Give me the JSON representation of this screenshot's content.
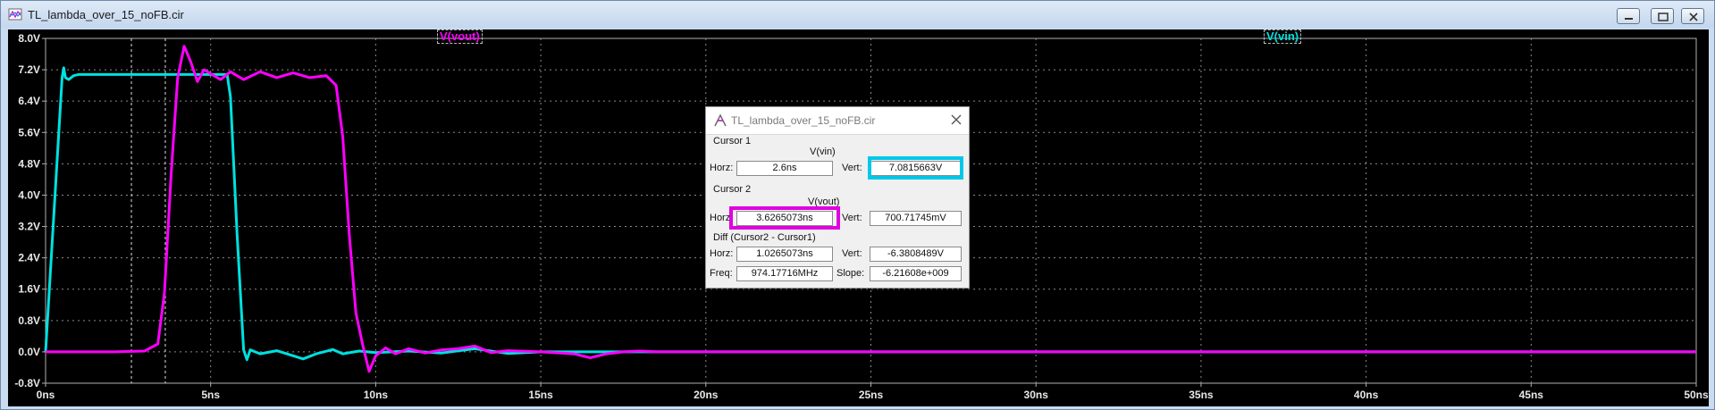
{
  "window": {
    "title": "TL_lambda_over_15_noFB.cir",
    "icon": "waveform-viewer-icon"
  },
  "plot": {
    "traces": [
      {
        "label": "V(vout)",
        "color": "#ff00ff"
      },
      {
        "label": "V(vin)",
        "color": "#00e0e0"
      }
    ],
    "y_ticks": [
      "8.0V",
      "7.2V",
      "6.4V",
      "5.6V",
      "4.8V",
      "4.0V",
      "3.2V",
      "2.4V",
      "1.6V",
      "0.8V",
      "0.0V",
      "-0.8V"
    ],
    "x_ticks": [
      "0ns",
      "5ns",
      "10ns",
      "15ns",
      "20ns",
      "25ns",
      "30ns",
      "35ns",
      "40ns",
      "45ns",
      "50ns"
    ]
  },
  "chart_data": {
    "type": "line",
    "xlim": [
      0,
      50
    ],
    "ylim": [
      -0.8,
      8.0
    ],
    "xlabel": "",
    "ylabel": "",
    "grid": true,
    "series": [
      {
        "name": "V(vin)",
        "x": [
          0,
          0.5,
          0.55,
          0.6,
          0.7,
          0.85,
          1.0,
          2.0,
          3.0,
          4.0,
          5.0,
          5.5,
          5.6,
          5.8,
          6.0,
          6.1,
          6.2,
          6.5,
          7.0,
          7.5,
          7.8,
          8.2,
          8.7,
          9.0,
          9.5,
          10,
          11,
          12,
          13,
          14,
          15,
          20,
          30,
          40,
          50
        ],
        "y": [
          0,
          7.0,
          7.25,
          7.0,
          6.95,
          7.05,
          7.08,
          7.08,
          7.08,
          7.08,
          7.08,
          7.08,
          6.5,
          3.0,
          0.05,
          -0.2,
          0.05,
          -0.05,
          0.03,
          -0.1,
          -0.18,
          -0.05,
          0.06,
          -0.05,
          0.02,
          -0.02,
          0.02,
          -0.03,
          0.08,
          -0.04,
          0.0,
          0.0,
          0.0,
          0.0,
          0.0
        ]
      },
      {
        "name": "V(vout)",
        "x": [
          0,
          1.0,
          2.0,
          3.0,
          3.4,
          3.6,
          3.8,
          4.0,
          4.2,
          4.4,
          4.6,
          4.8,
          5.0,
          5.3,
          5.6,
          6.0,
          6.5,
          7.0,
          7.5,
          8.0,
          8.5,
          8.8,
          9.0,
          9.2,
          9.4,
          9.6,
          9.8,
          10.0,
          10.3,
          10.6,
          11,
          11.5,
          12,
          12.5,
          13,
          13.5,
          14,
          15,
          16,
          16.5,
          17,
          17.5,
          18,
          18.5,
          20,
          50
        ],
        "y": [
          0,
          0,
          0,
          0.02,
          0.2,
          1.5,
          4.5,
          7.0,
          7.8,
          7.4,
          6.9,
          7.2,
          7.1,
          6.95,
          7.15,
          6.95,
          7.15,
          7.0,
          7.12,
          7.0,
          7.05,
          6.8,
          5.5,
          3.0,
          1.0,
          0.2,
          -0.5,
          -0.1,
          0.1,
          -0.05,
          0.08,
          -0.03,
          0.05,
          0.08,
          0.15,
          -0.02,
          0.03,
          0.0,
          -0.05,
          -0.15,
          -0.05,
          0.0,
          0.02,
          0.0,
          0.0,
          0.0
        ]
      }
    ]
  },
  "cursor_dialog": {
    "title": "TL_lambda_over_15_noFB.cir",
    "cursor1": {
      "label": "Cursor 1",
      "trace": "V(vin)",
      "horz_label": "Horz:",
      "horz": "2.6ns",
      "vert_label": "Vert:",
      "vert": "7.0815663V"
    },
    "cursor2": {
      "label": "Cursor 2",
      "trace": "V(vout)",
      "horz_label": "Horz:",
      "horz": "3.6265073ns",
      "vert_label": "Vert:",
      "vert": "700.71745mV"
    },
    "diff": {
      "label": "Diff (Cursor2 - Cursor1)",
      "horz_label": "Horz:",
      "horz": "1.0265073ns",
      "vert_label": "Vert:",
      "vert": "-6.3808489V",
      "freq_label": "Freq:",
      "freq": "974.17716MHz",
      "slope_label": "Slope:",
      "slope": "-6.21608e+009"
    }
  }
}
